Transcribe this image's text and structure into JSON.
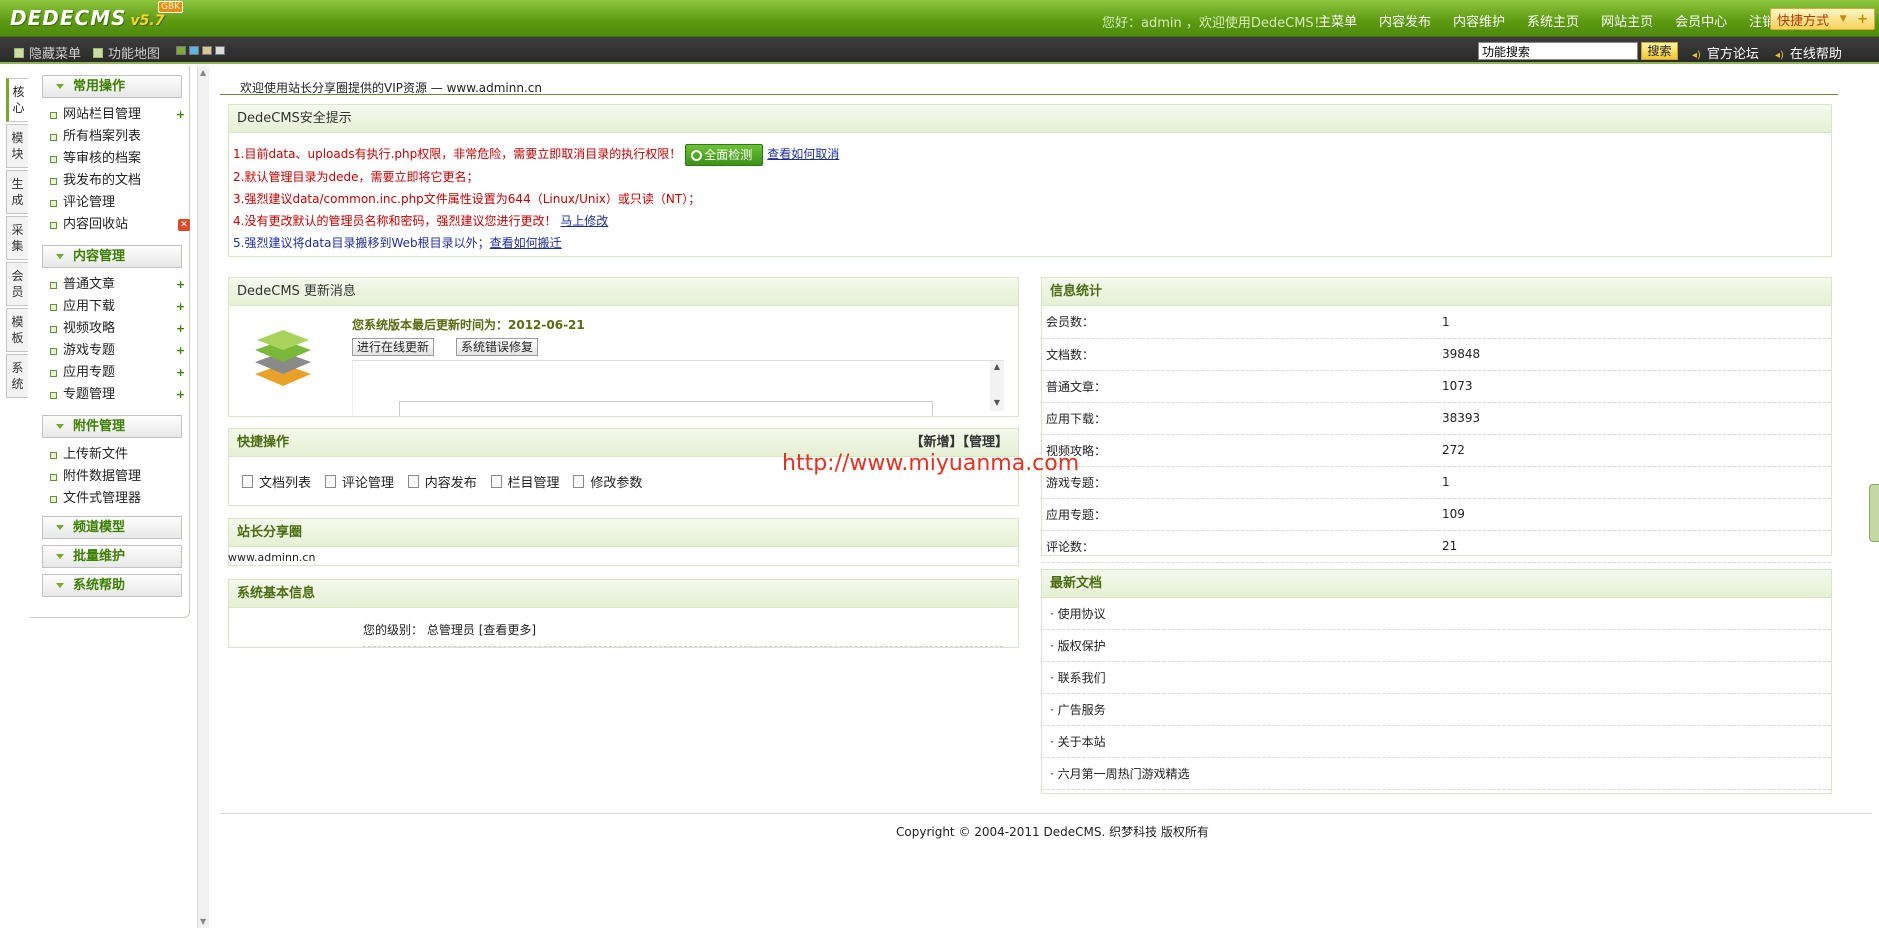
{
  "header": {
    "logo_main": "DEDECMS",
    "logo_version": "v5.7",
    "logo_badge": "GBK",
    "greeting": "您好：admin ，欢迎使用DedeCMS！",
    "nav": [
      "主菜单",
      "内容发布",
      "内容维护",
      "系统主页",
      "网站主页",
      "会员中心",
      "注销"
    ],
    "quick_label": "快捷方式"
  },
  "toolbar": {
    "hide_menu": "隐藏菜单",
    "feature_map": "功能地图",
    "swatch_colors": [
      "#7ea93b",
      "#5db4e0",
      "#d7c898",
      "#d9d9d9"
    ],
    "search_value": "功能搜索",
    "search_button": "搜索",
    "forum_link": "官方论坛",
    "help_link": "在线帮助"
  },
  "vtabs": [
    "核心",
    "模块",
    "生成",
    "采集",
    "会员",
    "模板",
    "系统"
  ],
  "menu": {
    "groups": [
      {
        "title": "常用操作",
        "items": [
          "网站栏目管理",
          "所有档案列表",
          "等审核的档案",
          "我发布的文档",
          "评论管理",
          "内容回收站"
        ]
      },
      {
        "title": "内容管理",
        "items": [
          "普通文章",
          "应用下载",
          "视频攻略",
          "游戏专题",
          "应用专题",
          "专题管理"
        ]
      },
      {
        "title": "附件管理",
        "items": [
          "上传新文件",
          "附件数据管理",
          "文件式管理器"
        ]
      },
      {
        "title": "频道模型",
        "items": []
      },
      {
        "title": "批量维护",
        "items": []
      },
      {
        "title": "系统帮助",
        "items": []
      }
    ]
  },
  "main": {
    "welcome": "欢迎使用站长分享圈提供的VIP资源 — www.adminn.cn",
    "security": {
      "title": "DedeCMS安全提示",
      "line1": "1.目前data、uploads有执行.php权限，非常危险，需要立即取消目录的执行权限！",
      "check_button": "全面检测",
      "line1_link": "查看如何取消",
      "line2": "2.默认管理目录为dede，需要立即将它更名；",
      "line3": "3.强烈建议data/common.inc.php文件属性设置为644（Linux/Unix）或只读（NT）；",
      "line4": "4.没有更改默认的管理员名称和密码，强烈建议您进行更改！",
      "line4_link": "马上修改",
      "line5": "5.强烈建议将data目录搬移到Web根目录以外；",
      "line5_link": "查看如何搬迁"
    },
    "update": {
      "title": "DedeCMS 更新消息",
      "last_update": "您系统版本最后更新时间为：2012-06-21",
      "online_update": "进行在线更新",
      "bug_fix": "系统错误修复"
    },
    "quick_ops": {
      "title": "快捷操作",
      "actions": "【新增】【管理】",
      "items": [
        "文档列表",
        "评论管理",
        "内容发布",
        "栏目管理",
        "修改参数"
      ]
    },
    "share": {
      "title": "站长分享圈",
      "text": "www.adminn.cn"
    },
    "sysinfo": {
      "title": "系统基本信息",
      "level_label": "您的级别：",
      "level_value": "总管理员",
      "more": "[查看更多]"
    },
    "stats": {
      "title": "信息统计",
      "rows": [
        {
          "label": "会员数：",
          "value": "1"
        },
        {
          "label": "文档数：",
          "value": "39848"
        },
        {
          "label": "普通文章：",
          "value": "1073"
        },
        {
          "label": "应用下载：",
          "value": "38393"
        },
        {
          "label": "视频攻略：",
          "value": "272"
        },
        {
          "label": "游戏专题：",
          "value": "1"
        },
        {
          "label": "应用专题：",
          "value": "109"
        },
        {
          "label": "评论数：",
          "value": "21"
        }
      ]
    },
    "latest": {
      "title": "最新文档",
      "items": [
        "· 使用协议",
        "· 版权保护",
        "· 联系我们",
        "· 广告服务",
        "· 关于本站",
        "· 六月第一周热门游戏精选"
      ]
    },
    "footer": "Copyright © 2004-2011 DedeCMS. 织梦科技 版权所有",
    "watermark": "http://www.miyuanma.com"
  }
}
